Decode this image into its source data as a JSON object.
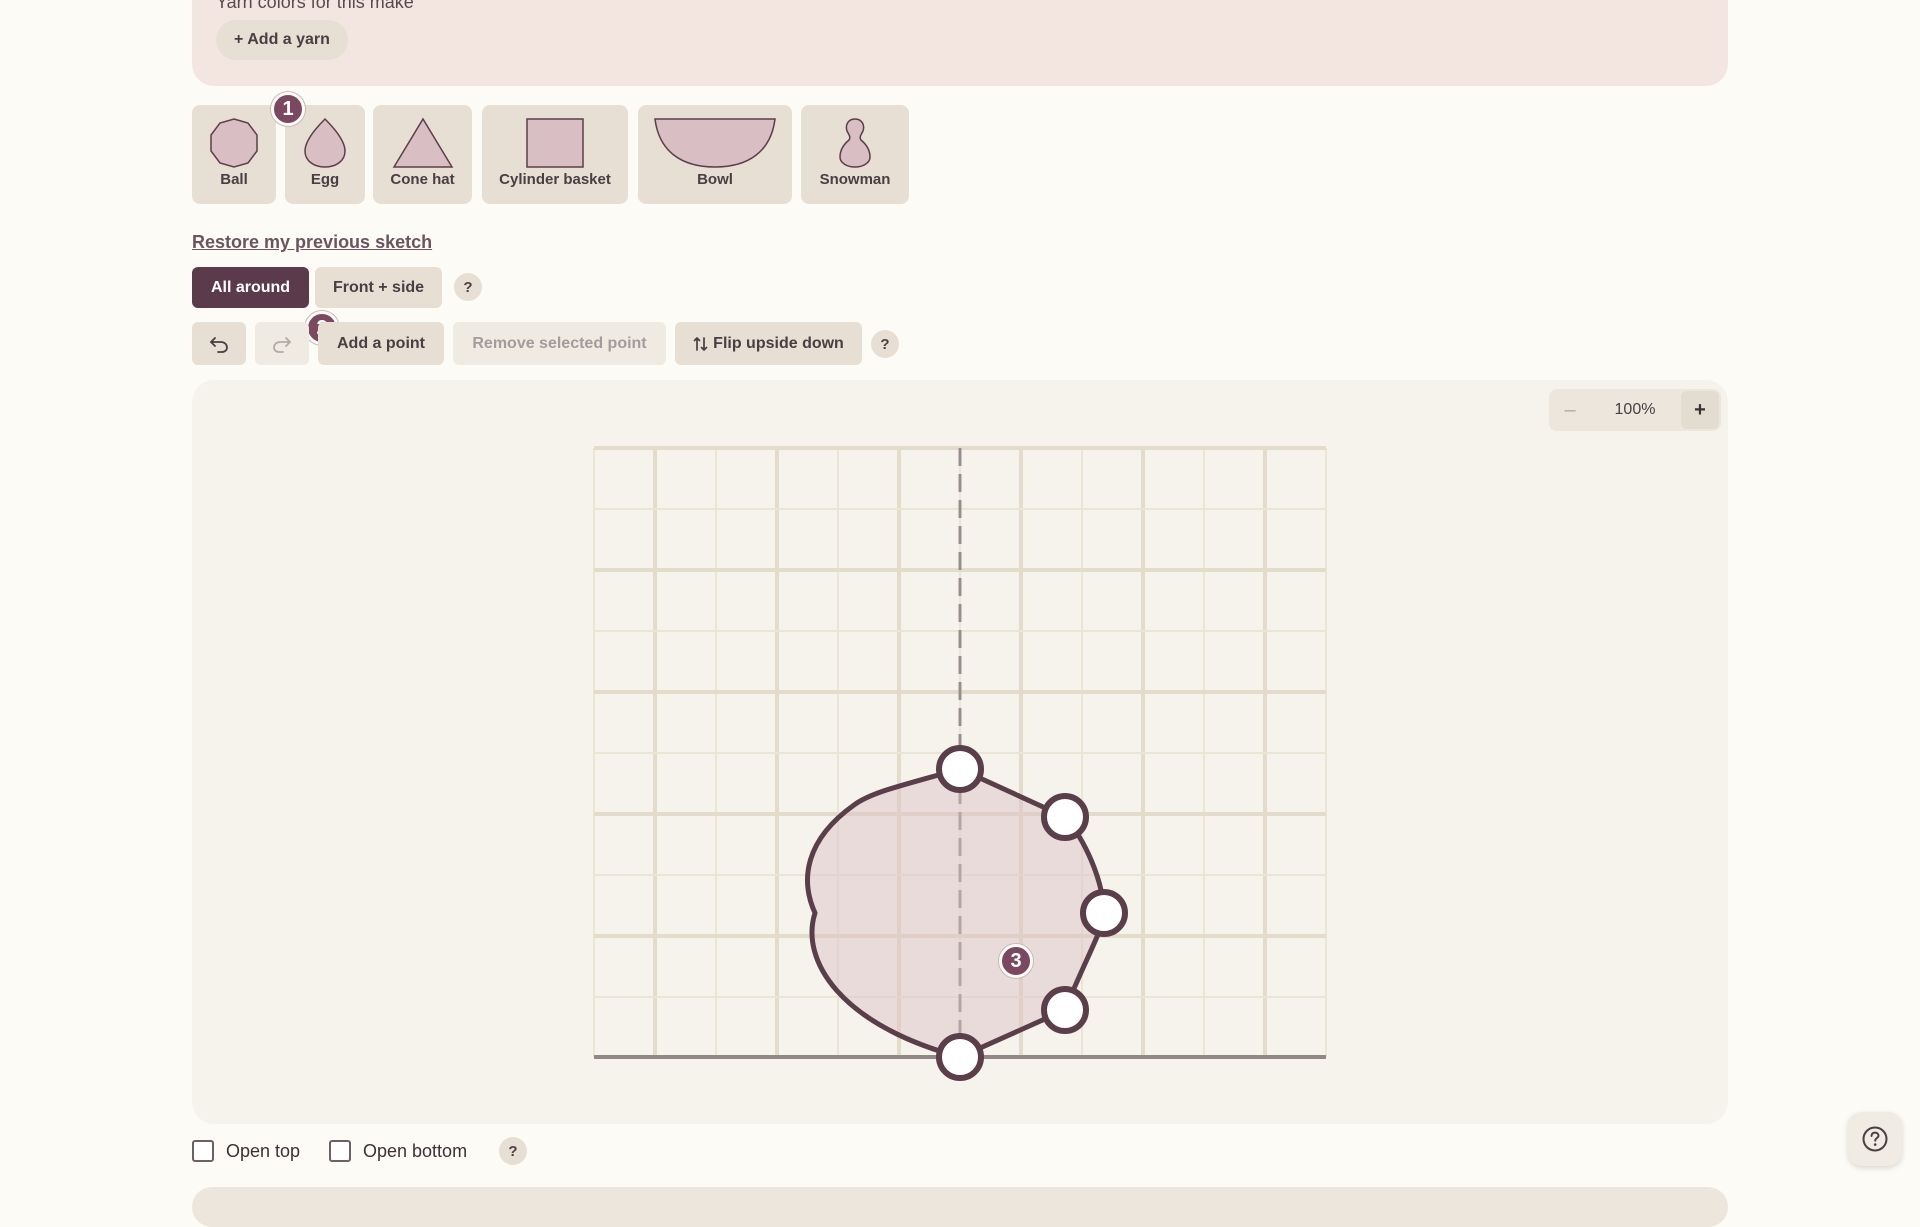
{
  "yarn": {
    "title": "Yarn colors for this make",
    "add_label": "+ Add a yarn"
  },
  "shapes": [
    {
      "label": "Ball",
      "icon": "ball-shape-icon"
    },
    {
      "label": "Egg",
      "icon": "egg-shape-icon"
    },
    {
      "label": "Cone hat",
      "icon": "cone-shape-icon"
    },
    {
      "label": "Cylinder basket",
      "icon": "cylinder-shape-icon"
    },
    {
      "label": "Bowl",
      "icon": "bowl-shape-icon"
    },
    {
      "label": "Snowman",
      "icon": "snowman-shape-icon"
    }
  ],
  "badges": [
    "1",
    "2",
    "3"
  ],
  "restore_label": "Restore my previous sketch",
  "view_modes": {
    "options": [
      "All around",
      "Front + side"
    ],
    "selected": "All around",
    "help": "?"
  },
  "toolbar": {
    "undo_icon": "undo-icon",
    "redo_icon": "redo-icon",
    "add_point": "Add a point",
    "remove_point": "Remove selected point",
    "flip": "Flip upside down",
    "flip_icon": "swap-vertical-icon",
    "help": "?"
  },
  "zoom": {
    "minus": "–",
    "value": "100%",
    "plus": "+"
  },
  "options": {
    "open_top": "Open top",
    "open_bottom": "Open bottom",
    "open_top_checked": false,
    "open_bottom_checked": false,
    "help": "?"
  },
  "colors": {
    "accent": "#5b3a4b",
    "badge": "#7a4860",
    "shape_fill": "#d9bfc3",
    "outline": "#5a3e4a",
    "grid_major": "#e3dcca",
    "grid_minor": "#ebe5d6",
    "canvas_bg": "#f5f3ec"
  }
}
